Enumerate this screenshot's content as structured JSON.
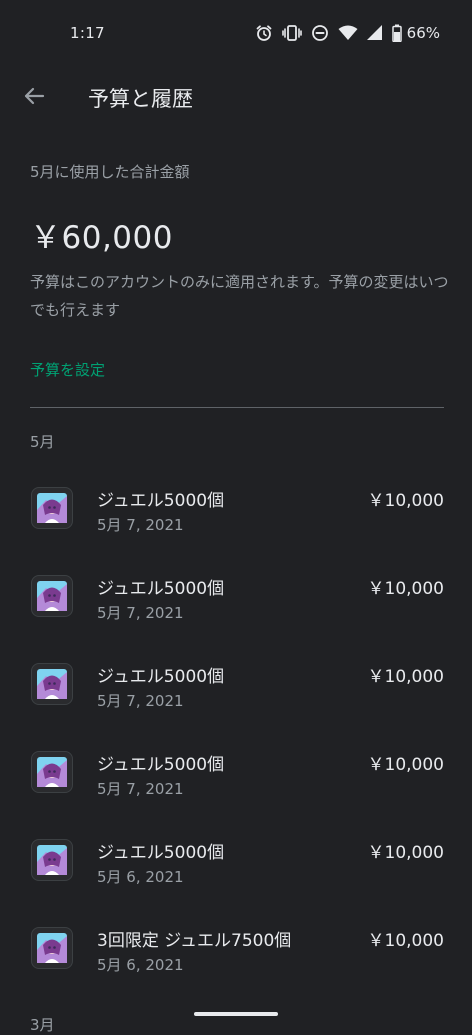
{
  "status_bar": {
    "time": "1:17",
    "battery_percent": "66%",
    "icons": [
      "alarm-icon",
      "vibrate-icon",
      "do-not-disturb-icon",
      "wifi-icon",
      "signal-icon",
      "battery-icon"
    ]
  },
  "app_bar": {
    "title": "予算と履歴",
    "back_icon": "arrow-back-icon"
  },
  "summary": {
    "label": "5月に使用した合計金額",
    "total": "￥60,000",
    "note": "予算はこのアカウントのみに適用されます。予算の変更はいつでも行えます",
    "set_budget_label": "予算を設定"
  },
  "colors": {
    "background": "#202124",
    "accent": "#00a173",
    "primary_text": "#e8eaed",
    "secondary_text": "#9aa0a6",
    "divider": "#5f6368"
  },
  "history": {
    "month": "5月",
    "next_month_peek": "3月",
    "items": [
      {
        "name": "ジュエル5000個",
        "date": "5月 7, 2021",
        "price": "￥10,000"
      },
      {
        "name": "ジュエル5000個",
        "date": "5月 7, 2021",
        "price": "￥10,000"
      },
      {
        "name": "ジュエル5000個",
        "date": "5月 7, 2021",
        "price": "￥10,000"
      },
      {
        "name": "ジュエル5000個",
        "date": "5月 7, 2021",
        "price": "￥10,000"
      },
      {
        "name": "ジュエル5000個",
        "date": "5月 6, 2021",
        "price": "￥10,000"
      },
      {
        "name": "3回限定 ジュエル7500個",
        "date": "5月 6, 2021",
        "price": "￥10,000"
      }
    ]
  }
}
